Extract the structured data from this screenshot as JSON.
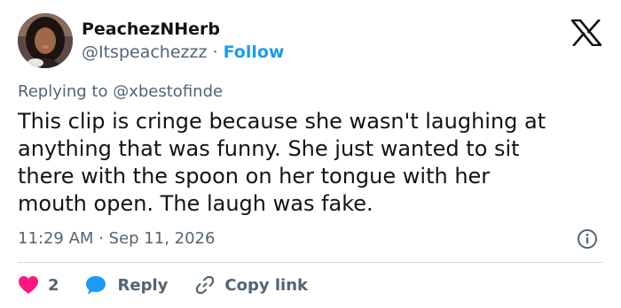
{
  "author": {
    "display_name": "PeachezNHerb",
    "handle": "@Itspeachezzz",
    "separator": "·",
    "follow_label": "Follow"
  },
  "reply_context": {
    "prefix": "Replying to",
    "target": "@xbestofinde"
  },
  "tweet": {
    "text_lines": [
      "This clip is cringe because she wasn't laughing at",
      "anything that was funny. She just wanted to sit",
      "there with the spoon on her tongue with her",
      "mouth open. The laugh was fake."
    ],
    "time": "11:29 AM",
    "time_separator": "·",
    "date": "Sep 11, 2026"
  },
  "actions": {
    "like_count": "2",
    "reply_label": "Reply",
    "copy_link_label": "Copy link"
  },
  "icons": {
    "brand": "x-logo-icon",
    "info": "info-icon",
    "like": "heart-icon",
    "reply": "speech-bubble-icon",
    "copy": "link-icon"
  },
  "colors": {
    "accent": "#1d9bf0",
    "like": "#f91880",
    "muted_text": "#536471",
    "text": "#0f1419",
    "divider": "#cfd9de"
  }
}
